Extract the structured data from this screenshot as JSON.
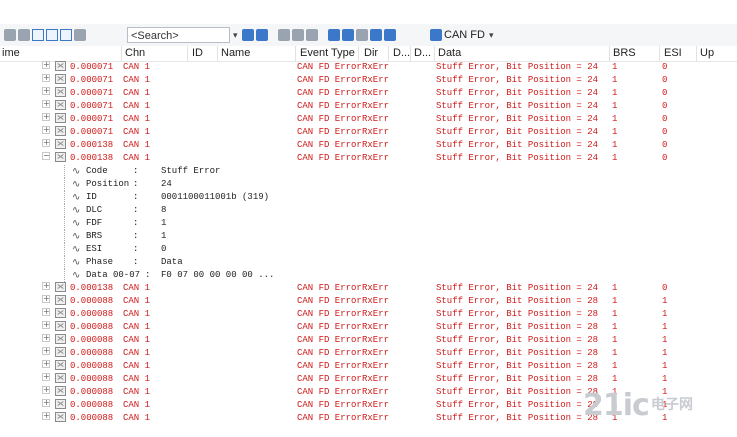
{
  "toolbar": {
    "search_placeholder": "<Search>",
    "protocol_label": "CAN FD"
  },
  "columns": [
    "ime",
    "Chn",
    "ID",
    "Name",
    "Event Type",
    "Dir",
    "D...",
    "D...",
    "Data",
    "BRS",
    "ESI",
    "Up"
  ],
  "rows_top": [
    {
      "time": "0.000071",
      "chn": "CAN 1",
      "event": "CAN FD Error",
      "dir": "RxErr",
      "data": "Stuff Error, Bit Position = 24",
      "brs": "1",
      "esi": "0"
    },
    {
      "time": "0.000071",
      "chn": "CAN 1",
      "event": "CAN FD Error",
      "dir": "RxErr",
      "data": "Stuff Error, Bit Position = 24",
      "brs": "1",
      "esi": "0"
    },
    {
      "time": "0.000071",
      "chn": "CAN 1",
      "event": "CAN FD Error",
      "dir": "RxErr",
      "data": "Stuff Error, Bit Position = 24",
      "brs": "1",
      "esi": "0"
    },
    {
      "time": "0.000071",
      "chn": "CAN 1",
      "event": "CAN FD Error",
      "dir": "RxErr",
      "data": "Stuff Error, Bit Position = 24",
      "brs": "1",
      "esi": "0"
    },
    {
      "time": "0.000071",
      "chn": "CAN 1",
      "event": "CAN FD Error",
      "dir": "RxErr",
      "data": "Stuff Error, Bit Position = 24",
      "brs": "1",
      "esi": "0"
    },
    {
      "time": "0.000071",
      "chn": "CAN 1",
      "event": "CAN FD Error",
      "dir": "RxErr",
      "data": "Stuff Error, Bit Position = 24",
      "brs": "1",
      "esi": "0"
    },
    {
      "time": "0.000138",
      "chn": "CAN 1",
      "event": "CAN FD Error",
      "dir": "RxErr",
      "data": "Stuff Error, Bit Position = 24",
      "brs": "1",
      "esi": "0"
    },
    {
      "time": "0.000138",
      "chn": "CAN 1",
      "event": "CAN FD Error",
      "dir": "RxErr",
      "data": "Stuff Error, Bit Position = 24",
      "brs": "1",
      "esi": "0"
    }
  ],
  "details": [
    {
      "name": "Code",
      "value": "Stuff Error"
    },
    {
      "name": "Position",
      "value": "24"
    },
    {
      "name": "ID",
      "value": "0001100011001b (319)"
    },
    {
      "name": "DLC",
      "value": "8"
    },
    {
      "name": "FDF",
      "value": "1"
    },
    {
      "name": "BRS",
      "value": "1"
    },
    {
      "name": "ESI",
      "value": "0"
    },
    {
      "name": "Phase",
      "value": "Data"
    },
    {
      "name": "Data 00-07",
      "value": "F0 07 00 00 00 00  ..."
    }
  ],
  "rows_bottom": [
    {
      "time": "0.000138",
      "chn": "CAN 1",
      "event": "CAN FD Error",
      "dir": "RxErr",
      "data": "Stuff Error, Bit Position = 24",
      "brs": "1",
      "esi": "0"
    },
    {
      "time": "0.000088",
      "chn": "CAN 1",
      "event": "CAN FD Error",
      "dir": "RxErr",
      "data": "Stuff Error, Bit Position = 28",
      "brs": "1",
      "esi": "1"
    },
    {
      "time": "0.000088",
      "chn": "CAN 1",
      "event": "CAN FD Error",
      "dir": "RxErr",
      "data": "Stuff Error, Bit Position = 28",
      "brs": "1",
      "esi": "1"
    },
    {
      "time": "0.000088",
      "chn": "CAN 1",
      "event": "CAN FD Error",
      "dir": "RxErr",
      "data": "Stuff Error, Bit Position = 28",
      "brs": "1",
      "esi": "1"
    },
    {
      "time": "0.000088",
      "chn": "CAN 1",
      "event": "CAN FD Error",
      "dir": "RxErr",
      "data": "Stuff Error, Bit Position = 28",
      "brs": "1",
      "esi": "1"
    },
    {
      "time": "0.000088",
      "chn": "CAN 1",
      "event": "CAN FD Error",
      "dir": "RxErr",
      "data": "Stuff Error, Bit Position = 28",
      "brs": "1",
      "esi": "1"
    },
    {
      "time": "0.000088",
      "chn": "CAN 1",
      "event": "CAN FD Error",
      "dir": "RxErr",
      "data": "Stuff Error, Bit Position = 28",
      "brs": "1",
      "esi": "1"
    },
    {
      "time": "0.000088",
      "chn": "CAN 1",
      "event": "CAN FD Error",
      "dir": "RxErr",
      "data": "Stuff Error, Bit Position = 28",
      "brs": "1",
      "esi": "1"
    },
    {
      "time": "0.000088",
      "chn": "CAN 1",
      "event": "CAN FD Error",
      "dir": "RxErr",
      "data": "Stuff Error, Bit Position = 28",
      "brs": "1",
      "esi": "1"
    },
    {
      "time": "0.000088",
      "chn": "CAN 1",
      "event": "CAN FD Error",
      "dir": "RxErr",
      "data": "Stuff Error, Bit Position = 28",
      "brs": "1",
      "esi": "1"
    },
    {
      "time": "0.000088",
      "chn": "CAN 1",
      "event": "CAN FD Error",
      "dir": "RxErr",
      "data": "Stuff Error, Bit Position = 28",
      "brs": "1",
      "esi": "1"
    }
  ],
  "watermark": {
    "main": "21ic",
    "sub": "电子网"
  },
  "colors": {
    "error_text": "#d11a1a",
    "accent": "#3b78c9"
  }
}
